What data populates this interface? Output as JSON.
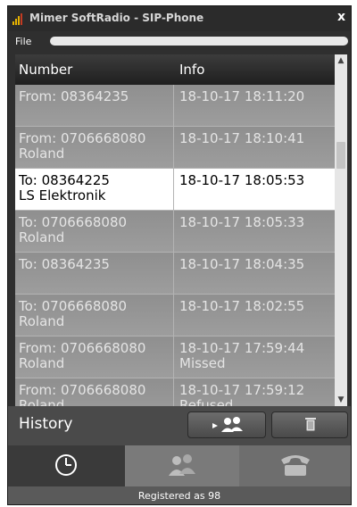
{
  "window": {
    "title": "Mimer SoftRadio - SIP-Phone",
    "close_symbol": "x"
  },
  "menu": {
    "file_label": "File"
  },
  "table": {
    "headers": {
      "number": "Number",
      "info": "Info"
    },
    "rows": [
      {
        "line1": "From: 08364235",
        "line2": "",
        "info1": "18-10-17 18:11:20",
        "info2": ""
      },
      {
        "line1": "From: 0706668080",
        "line2": "Roland",
        "info1": "18-10-17 18:10:41",
        "info2": ""
      },
      {
        "line1": "To: 08364225",
        "line2": "LS Elektronik",
        "info1": "18-10-17 18:05:53",
        "info2": "",
        "selected": true
      },
      {
        "line1": "To: 0706668080",
        "line2": "Roland",
        "info1": "18-10-17 18:05:33",
        "info2": ""
      },
      {
        "line1": "To: 08364235",
        "line2": "",
        "info1": "18-10-17 18:04:35",
        "info2": ""
      },
      {
        "line1": "To: 0706668080",
        "line2": "Roland",
        "info1": "18-10-17 18:02:55",
        "info2": ""
      },
      {
        "line1": "From: 0706668080",
        "line2": "Roland",
        "info1": "18-10-17 17:59:44",
        "info2": "Missed"
      },
      {
        "line1": "From: 0706668080",
        "line2": "Roland",
        "info1": "18-10-17 17:59:12",
        "info2": "Refused"
      }
    ]
  },
  "bottom": {
    "history_label": "History",
    "contacts_button_icon": "play-contacts-icon",
    "delete_button_icon": "trash-icon"
  },
  "nav": {
    "tabs": [
      {
        "icon": "clock-icon",
        "active": true
      },
      {
        "icon": "contacts-icon",
        "active": false
      },
      {
        "icon": "phone-icon",
        "active": false
      }
    ]
  },
  "status": {
    "text": "Registered as 98"
  },
  "colors": {
    "accent_logo": "#e8b400",
    "selected_row": "#ffffff",
    "row_bg": "#969696"
  }
}
